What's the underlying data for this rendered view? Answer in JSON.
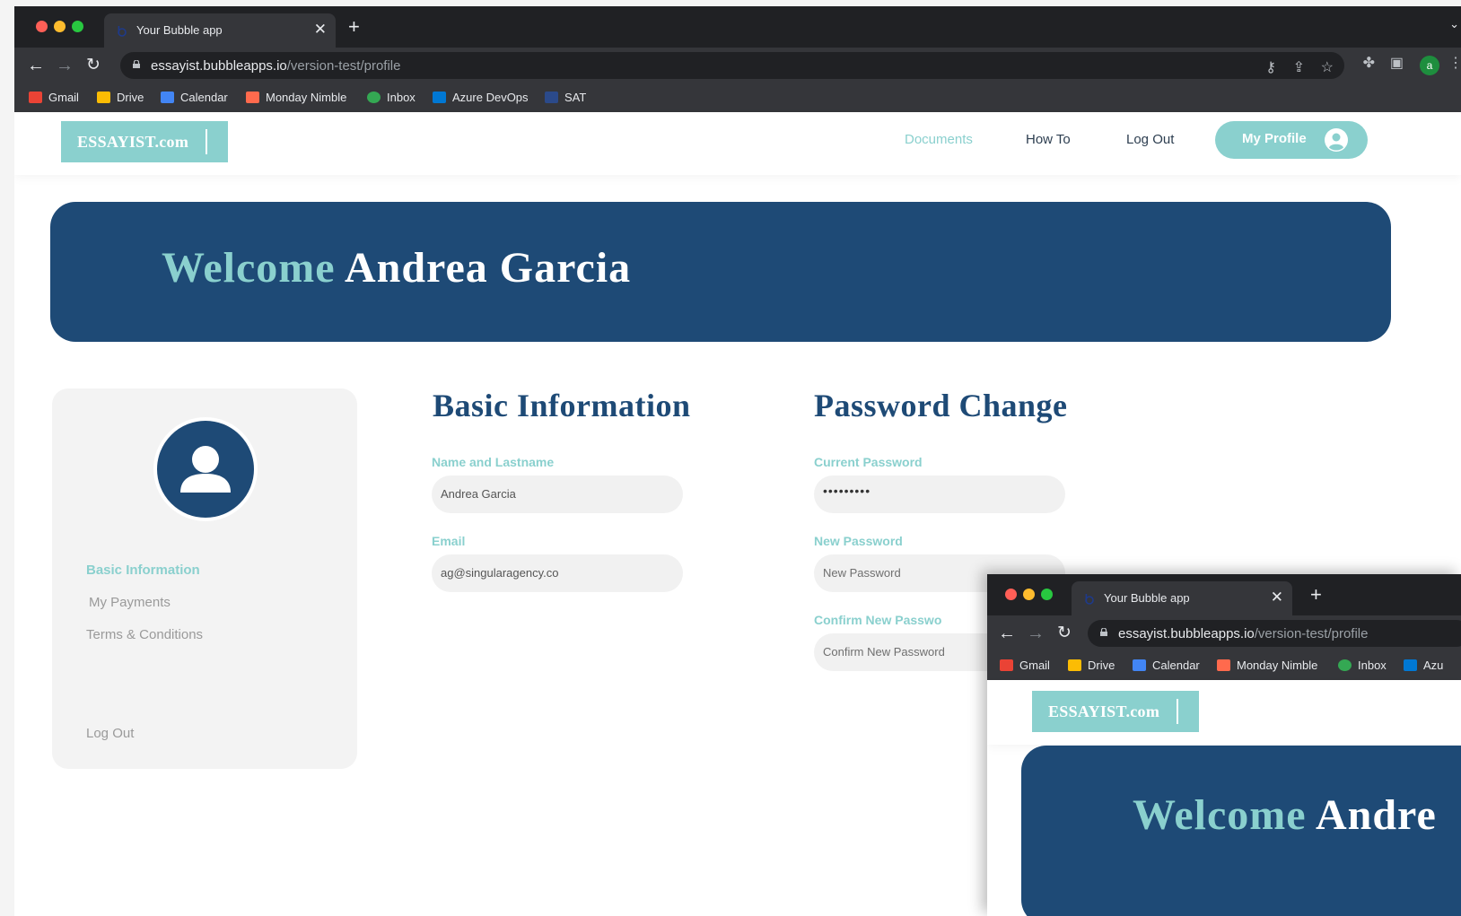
{
  "browser": {
    "tab_title": "Your Bubble app",
    "url_host": "essayist.bubbleapps.io",
    "url_path": "/version-test/profile",
    "profile_initial": "a",
    "bookmarks": [
      "Gmail",
      "Drive",
      "Calendar",
      "Monday Nimble",
      "Inbox",
      "Azure DevOps",
      "SAT"
    ],
    "sub_bookmarks": [
      "Gmail",
      "Drive",
      "Calendar",
      "Monday Nimble",
      "Inbox",
      "Azu"
    ]
  },
  "header": {
    "logo": "ESSAYIST.com",
    "nav": [
      "Documents",
      "How To",
      "Log Out"
    ],
    "profile_button": "My Profile"
  },
  "banner": {
    "welcome": "Welcome",
    "name": "Andrea Garcia",
    "sub_name": "Andre"
  },
  "sidebar": {
    "items": [
      "Basic Information",
      "My Payments",
      "Terms & Conditions"
    ],
    "logout": "Log Out"
  },
  "basic_info": {
    "title": "Basic Information",
    "name_label": "Name and Lastname",
    "name_value": "Andrea Garcia",
    "email_label": "Email",
    "email_value": "ag@singularagency.co"
  },
  "password": {
    "title": "Password Change",
    "current_label": "Current Password",
    "current_value": "•••••••••",
    "new_label": "New Password",
    "new_placeholder": "New Password",
    "confirm_label": "Confirm New Passwo",
    "confirm_placeholder": "Confirm New Password"
  },
  "colors": {
    "teal": "#8ad0ce",
    "navy": "#1e4a76",
    "chrome_dark": "#202124",
    "chrome_toolbar": "#35363a"
  }
}
